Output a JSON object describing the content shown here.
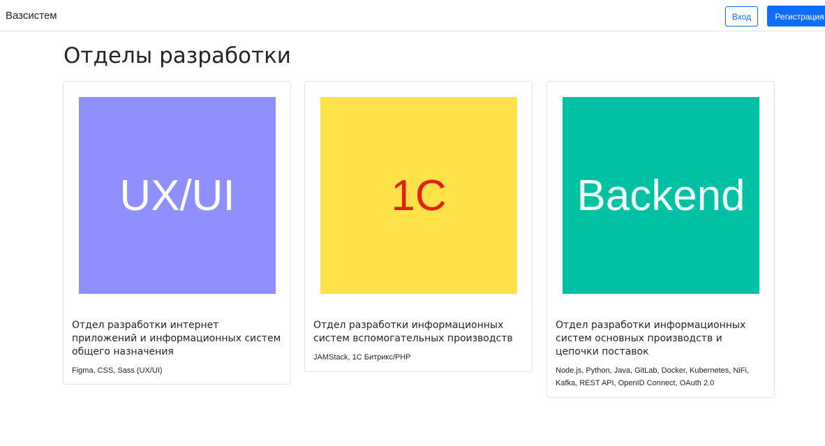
{
  "navbar": {
    "brand": "Вазсистем",
    "login_label": "Вход",
    "register_label": "Регистрация"
  },
  "main": {
    "title": "Отделы разработки",
    "cards": [
      {
        "image_text": "UX/UI",
        "image_bg": "#8f8fff",
        "image_fg": "#ffffff",
        "title": "Отдел разработки интернет приложений и информационных систем общего назначения",
        "text": "Figma, CSS, Sass (UX/UI)"
      },
      {
        "image_text": "1C",
        "image_bg": "#ffe14a",
        "image_fg": "#e61e0f",
        "title": "Отдел разработки информационных систем вспомогательных производств",
        "text": "JAMStack, 1C Битрикс/PHP"
      },
      {
        "image_text": "Backend",
        "image_bg": "#00c1a4",
        "image_fg": "#f0fff8",
        "title": "Отдел разработки информационных систем основных производств и цепочки поставок",
        "text": "Node.js, Python, Java, GitLab, Docker, Kubernetes, NiFi, Kafka, REST API, OpenID Connect, OAuth 2.0"
      }
    ]
  }
}
